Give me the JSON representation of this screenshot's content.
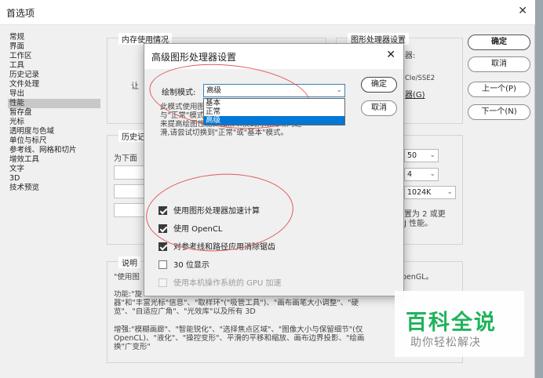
{
  "window": {
    "title": "首选项",
    "close_glyph": "✕"
  },
  "sidebar": {
    "items": [
      "常规",
      "界面",
      "工作区",
      "工具",
      "历史记录",
      "文件处理",
      "导出",
      "性能",
      "暂存盘",
      "光标",
      "透明度与色域",
      "单位与标尺",
      "参考线、网格和切片",
      "增效工具",
      "文字",
      "3D",
      "技术预览"
    ],
    "active_index": 7
  },
  "buttons": {
    "ok": "确定",
    "cancel": "取消",
    "prev": "上一个(P)",
    "next": "下一个(N)"
  },
  "memory_group": {
    "title": "内存使用情况",
    "partial_label": "让"
  },
  "gpu_group": {
    "title": "图形处理器设置",
    "partial_1": "器:",
    "partial_2": "CIe/SSE2",
    "partial_3": "器(G)"
  },
  "history_group": {
    "title": "历史记",
    "partial_label": "为下面",
    "history_value": "50",
    "cache_value": "4",
    "tile_value": "1024K",
    "desc_line1": "置为 2 或更",
    "desc_line2": "J 性能。"
  },
  "description_group": {
    "title": "说明",
    "line1": "\"使用图",
    "line1_right": "penGL。",
    "line2": "功能:\"旋",
    "line3": "器\"和\"丰富光标\"信息\"、\"取样环\"(\"吸管工具\")、\"画布画笔大小调整\"、\"硬",
    "line4": "览\"、\"自适应广角\"、\"光效库\"以及所有 3D",
    "line5": "增强:\"模糊画廊\"、\"智能锐化\"、\"选择焦点区域\"、\"图像大小与保留细节\"(仅",
    "line6": "OpenCL)、\"液化\"、\"操控变形\"、平滑的平移和缩放、画布边界投影、\"绘画",
    "line7": "换\"广变形\""
  },
  "advanced_dialog": {
    "title": "高级图形处理器设置",
    "close_glyph": "✕",
    "mode_label": "绘制模式:",
    "mode_value": "高级",
    "mode_options": [
      "基本",
      "正常",
      "高级"
    ],
    "mode_selected_index": 2,
    "ok": "确定",
    "cancel": "取消",
    "desc_line1": "此模式使用图",
    "desc_line2": "与\"正常\"模式",
    "desc_line3": "来提高绘图性能。如果以模式持续出现问题",
    "desc_line4": "滑,请尝试切换到\"正常\"或\"基本\"模式。",
    "checkboxes": [
      {
        "label": "使用图形处理器加速计算",
        "checked": true,
        "disabled": false
      },
      {
        "label": "使用 OpenCL",
        "checked": true,
        "disabled": false
      },
      {
        "label": "对参考线和路径应用消除锯齿",
        "checked": true,
        "disabled": false
      },
      {
        "label": "30 位显示",
        "checked": false,
        "disabled": false
      },
      {
        "label": "使用本机操作系统的 GPU 加速",
        "checked": false,
        "disabled": true
      }
    ]
  },
  "watermark": {
    "main": "百科全说",
    "sub": "助你轻松解决"
  },
  "colors": {
    "accent": "#0078d7",
    "annotation": "#e05a5a",
    "watermark": "#1fb35a"
  },
  "icons": {
    "close": "close-icon",
    "dropdown": "chevron-down-icon",
    "check": "check-icon"
  }
}
